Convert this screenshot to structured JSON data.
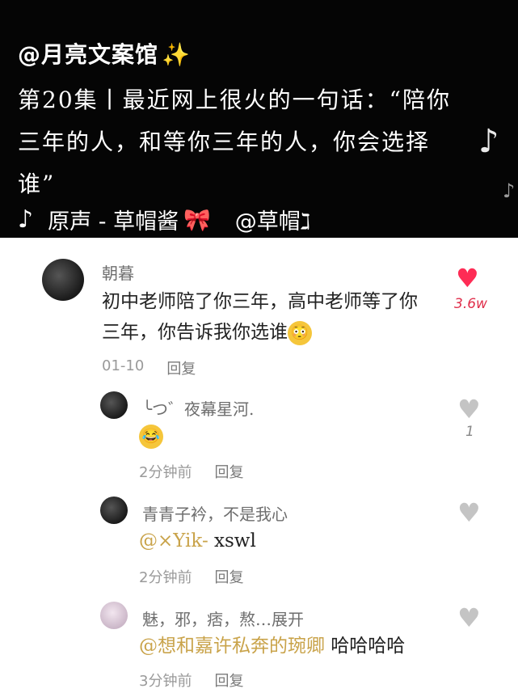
{
  "video": {
    "author": "@月亮文案馆",
    "sparkle": "✨",
    "caption": "第20集丨最近网上很火的一句话：“陪你三年的人，和等你三年的人，你会选择谁”",
    "music_title": "原声 - 草帽酱",
    "bow": "🎀",
    "music_artist": "@草帽ℷ",
    "icons": [
      "tiktok-logo-icon",
      "music-note-icon"
    ]
  },
  "colors": {
    "like_red": "#fe2c55",
    "mention_gold": "#c9a34a",
    "heart_gray": "#c4c4c4"
  },
  "comments": [
    {
      "user": "朝暮",
      "text": "初中老师陪了你三年，高中老师等了你三年，你告诉我你选谁",
      "emoji": "😳",
      "date": "01-10",
      "reply": "回复",
      "likes": "3.6w",
      "liked": true
    }
  ],
  "replies": [
    {
      "user": "╰つ゛夜幕星河.",
      "text": "😂",
      "date": "2分钟前",
      "reply": "回复",
      "likes": "1"
    },
    {
      "user": "青青子衿，不是我心",
      "mention": "@×Yik-",
      "text": " xswl",
      "date": "2分钟前",
      "reply": "回复",
      "likes": ""
    },
    {
      "user": "魅，邪，痞，熬…展开",
      "mention": "@想和嘉许私奔的琬卿",
      "text": " 哈哈哈哈",
      "date": "3分钟前",
      "reply": "回复",
      "likes": ""
    }
  ]
}
